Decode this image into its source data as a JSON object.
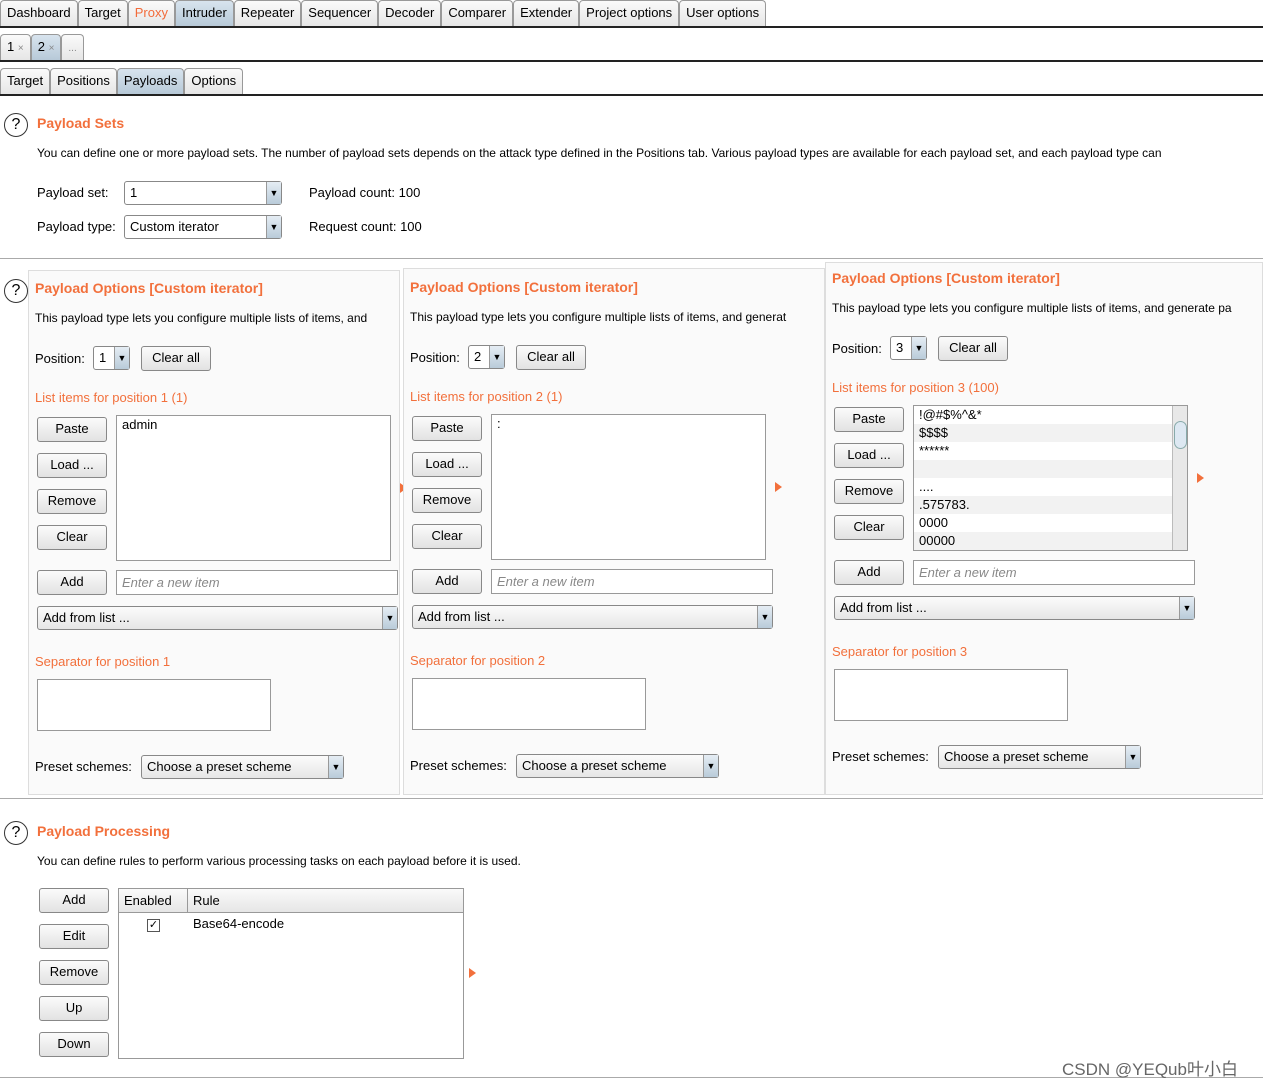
{
  "top_tabs": [
    "Dashboard",
    "Target",
    "Proxy",
    "Intruder",
    "Repeater",
    "Sequencer",
    "Decoder",
    "Comparer",
    "Extender",
    "Project options",
    "User options"
  ],
  "attack_tabs": [
    {
      "label": "1",
      "close": "×"
    },
    {
      "label": "2",
      "close": "×"
    },
    {
      "label": "..."
    }
  ],
  "sub_tabs": [
    "Target",
    "Positions",
    "Payloads",
    "Options"
  ],
  "payload_sets": {
    "title": "Payload Sets",
    "desc": "You can define one or more payload sets. The number of payload sets depends on the attack type defined in the Positions tab. Various payload types are available for each payload set, and each payload type can",
    "set_label": "Payload set:",
    "set_value": "1",
    "type_label": "Payload type:",
    "type_value": "Custom iterator",
    "count_label": "Payload count:",
    "count_value": "100",
    "req_label": "Request count:",
    "req_value": "100"
  },
  "options_panels": [
    {
      "title": "Payload Options [Custom iterator]",
      "desc": "This payload type lets you configure multiple lists of items, and",
      "position_label": "Position:",
      "position": "1",
      "clear_all": "Clear all",
      "list_title": "List items for position 1 (1)",
      "items": [
        "admin"
      ],
      "separator_title": "Separator for position 1"
    },
    {
      "title": "Payload Options [Custom iterator]",
      "desc": "This payload type lets you configure multiple lists of items, and generat",
      "position_label": "Position:",
      "position": "2",
      "clear_all": "Clear all",
      "list_title": "List items for position 2 (1)",
      "items": [
        ":"
      ],
      "separator_title": "Separator for position 2"
    },
    {
      "title": "Payload Options [Custom iterator]",
      "desc": "This payload type lets you configure multiple lists of items, and generate pa",
      "position_label": "Position:",
      "position": "3",
      "clear_all": "Clear all",
      "list_title": "List items for position 3 (100)",
      "items": [
        "!@#$%^&*",
        "$$$$",
        "******",
        "",
        "....",
        ".575783.",
        "0000",
        "00000"
      ],
      "separator_title": "Separator for position 3"
    }
  ],
  "list_buttons": {
    "paste": "Paste",
    "load": "Load ...",
    "remove": "Remove",
    "clear": "Clear",
    "add": "Add",
    "add_placeholder": "Enter a new item",
    "add_from_list": "Add from list ..."
  },
  "preset": {
    "label": "Preset schemes:",
    "value": "Choose a preset scheme"
  },
  "processing": {
    "title": "Payload Processing",
    "desc": "You can define rules to perform various processing tasks on each payload before it is used.",
    "buttons": [
      "Add",
      "Edit",
      "Remove",
      "Up",
      "Down"
    ],
    "columns": [
      "Enabled",
      "Rule"
    ],
    "rows": [
      {
        "enabled": true,
        "rule": "Base64-encode"
      }
    ]
  },
  "watermark": "CSDN @YEQub叶小白",
  "colors": {
    "accent": "#f2703c"
  }
}
